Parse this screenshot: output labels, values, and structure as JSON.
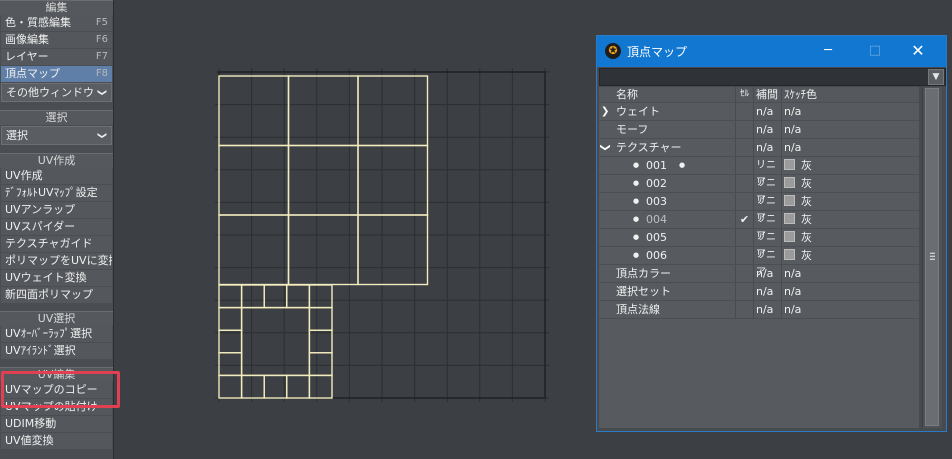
{
  "sidebar": {
    "sections": [
      {
        "title": "編集",
        "items": [
          {
            "label": "色・質感編集",
            "key": "F5"
          },
          {
            "label": "画像編集",
            "key": "F6"
          },
          {
            "label": "レイヤー",
            "key": "F7"
          },
          {
            "label": "頂点マップ",
            "key": "F8",
            "active": true
          }
        ],
        "dropdown": "その他ウィンドウ"
      },
      {
        "title": "選択",
        "dropdown": "選択"
      },
      {
        "title": "UV作成",
        "items": [
          {
            "label": "UV作成"
          },
          {
            "label": "ﾃﾞﾌｫﾙﾄUVﾏｯﾌﾟ設定"
          },
          {
            "label": "UVアンラップ"
          },
          {
            "label": "UVスパイダー"
          },
          {
            "label": "テクスチャガイド"
          },
          {
            "label": "ポリマップをUVに変換"
          },
          {
            "label": "UVウェイト変換"
          },
          {
            "label": "新四面ポリマップ"
          }
        ]
      },
      {
        "title": "UV選択",
        "items": [
          {
            "label": "UVｵｰﾊﾞｰﾗｯﾌﾟ選択"
          },
          {
            "label": "UVｱｲﾗﾝﾄﾞ選択"
          }
        ]
      },
      {
        "title": "UV編集",
        "items": [
          {
            "label": "UVマップのコピー"
          },
          {
            "label": "UVマップの貼付け"
          },
          {
            "label": "UDIM移動"
          },
          {
            "label": "UV値変換"
          }
        ]
      }
    ]
  },
  "vertex_map_window": {
    "title": "頂点マップ",
    "controls": {
      "minimize": "─",
      "maximize": "□",
      "close": "✕"
    },
    "columns": {
      "name": "名称",
      "cell": "ｾﾙ",
      "interp": "補間",
      "sketch_color": "ｽｹｯﾁ色"
    },
    "rows": [
      {
        "name": "ウェイト",
        "expander": "❯",
        "interp": "n/a",
        "sketch": "n/a",
        "level": 0
      },
      {
        "name": "モーフ",
        "interp": "n/a",
        "sketch": "n/a",
        "level": 0
      },
      {
        "name": "テクスチャー",
        "expander": "❯",
        "expanded": true,
        "interp": "n/a",
        "sketch": "n/a",
        "level": 0
      },
      {
        "name": "001",
        "level": 1,
        "selected_dot": true,
        "interp": "リニア",
        "sketch": "灰"
      },
      {
        "name": "002",
        "level": 1,
        "interp": "リニア",
        "sketch": "灰"
      },
      {
        "name": "003",
        "level": 1,
        "interp": "リニア",
        "sketch": "灰"
      },
      {
        "name": "004",
        "level": 1,
        "dim": true,
        "check": "✔",
        "interp": "リニア",
        "sketch": "灰"
      },
      {
        "name": "005",
        "level": 1,
        "interp": "リニア",
        "sketch": "灰"
      },
      {
        "name": "006",
        "level": 1,
        "interp": "リニア",
        "sketch": "灰"
      },
      {
        "name": "頂点カラー",
        "interp": "n/a",
        "sketch": "n/a",
        "level": 0
      },
      {
        "name": "選択セット",
        "interp": "n/a",
        "sketch": "n/a",
        "level": 0
      },
      {
        "name": "頂点法線",
        "interp": "n/a",
        "sketch": "n/a",
        "level": 0
      }
    ],
    "toolbar_dropdown_icon": "chevron-down-icon"
  },
  "colors": {
    "uv_line": "#f3ecbf",
    "grid_line": "#2c2e31",
    "highlight": "#e0404f",
    "title_bar": "#1177d0",
    "active_item": "#5f7fa8"
  }
}
